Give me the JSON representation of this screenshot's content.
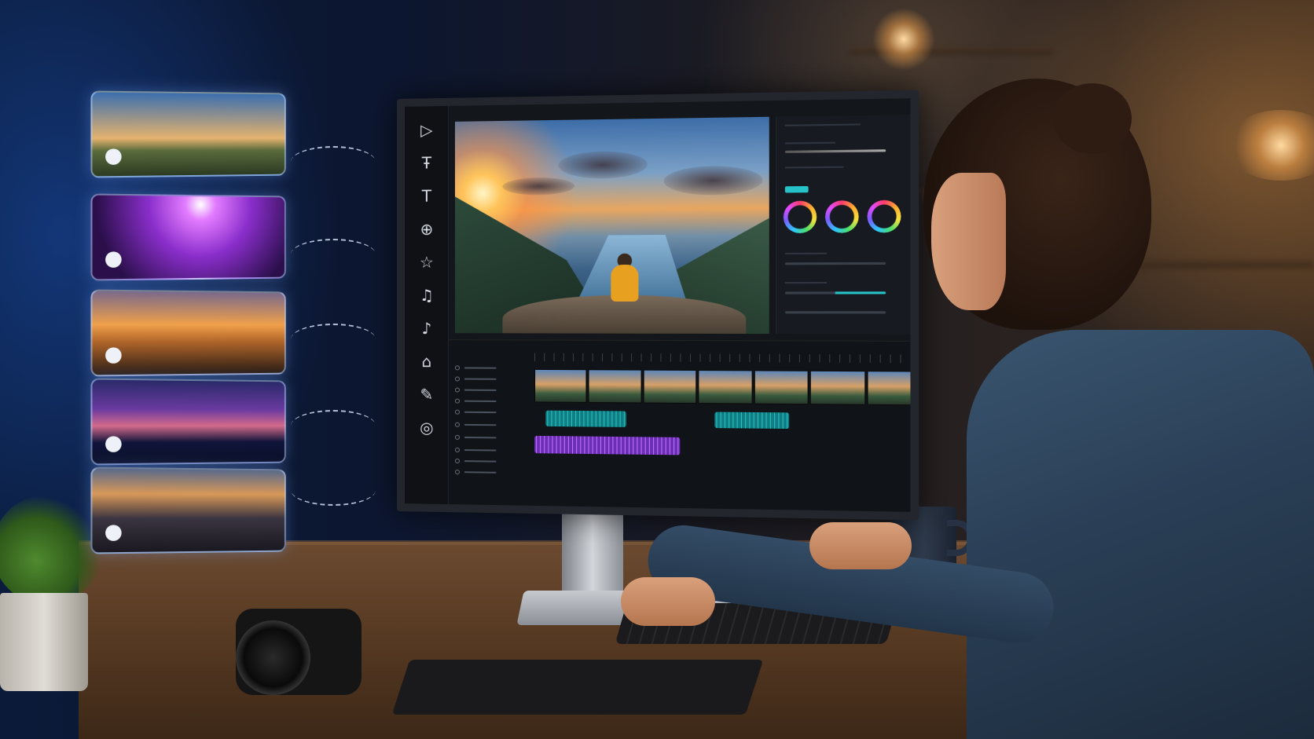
{
  "scene": {
    "description_label": "",
    "accent_colors": {
      "teal_audio": "#2fd4d8",
      "purple_audio": "#c471ff",
      "ui_accent": "#25c3c7",
      "thumb_glow": "#78aaff"
    }
  },
  "editor": {
    "tools": [
      {
        "icon": "play-icon",
        "glyph": "▷"
      },
      {
        "icon": "text-box-icon",
        "glyph": "Ŧ"
      },
      {
        "icon": "text-icon",
        "glyph": "T"
      },
      {
        "icon": "media-icon",
        "glyph": "⊕"
      },
      {
        "icon": "star-icon",
        "glyph": "☆"
      },
      {
        "icon": "music-icon",
        "glyph": "♫"
      },
      {
        "icon": "music-note-icon",
        "glyph": "♪"
      },
      {
        "icon": "transition-icon",
        "glyph": "⌂"
      },
      {
        "icon": "brush-icon",
        "glyph": "✎"
      },
      {
        "icon": "export-icon",
        "glyph": "◎"
      }
    ],
    "color_wheels": 3
  },
  "thumbnails": [
    {
      "icon": "record-dot-icon",
      "scene": "mountain-castle"
    },
    {
      "icon": "record-dot-icon",
      "scene": "concert"
    },
    {
      "icon": "record-dot-icon",
      "scene": "sunset-silhouette"
    },
    {
      "icon": "record-dot-icon",
      "scene": "city-night"
    },
    {
      "icon": "record-dot-icon",
      "scene": "street-evening"
    }
  ]
}
